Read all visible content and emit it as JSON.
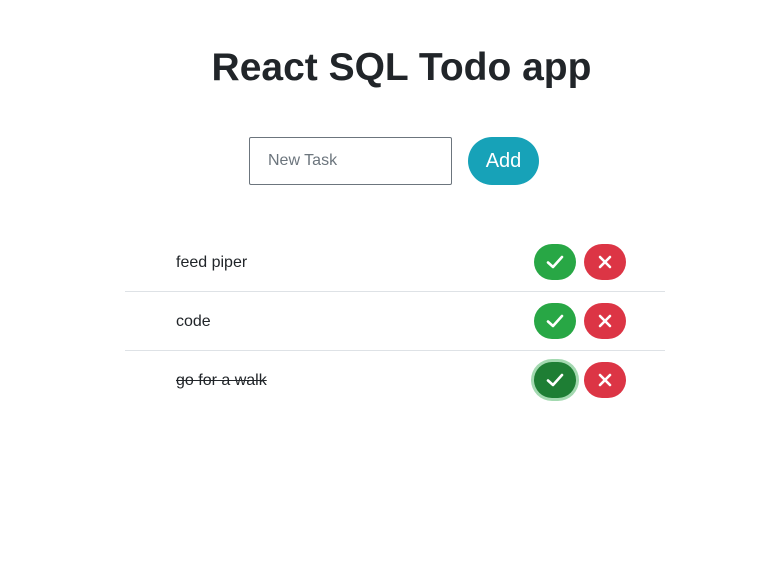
{
  "app": {
    "title": "React SQL Todo app"
  },
  "form": {
    "input_placeholder": "New Task",
    "input_value": "",
    "add_label": "Add"
  },
  "icons": {
    "complete": "check-icon",
    "delete": "close-icon"
  },
  "colors": {
    "add": "#17a2b8",
    "complete": "#28a745",
    "complete_active": "#1e7e34",
    "delete": "#dc3545"
  },
  "todos": [
    {
      "text": "feed piper",
      "completed": false
    },
    {
      "text": "code",
      "completed": false
    },
    {
      "text": "go for a walk",
      "completed": true
    }
  ]
}
